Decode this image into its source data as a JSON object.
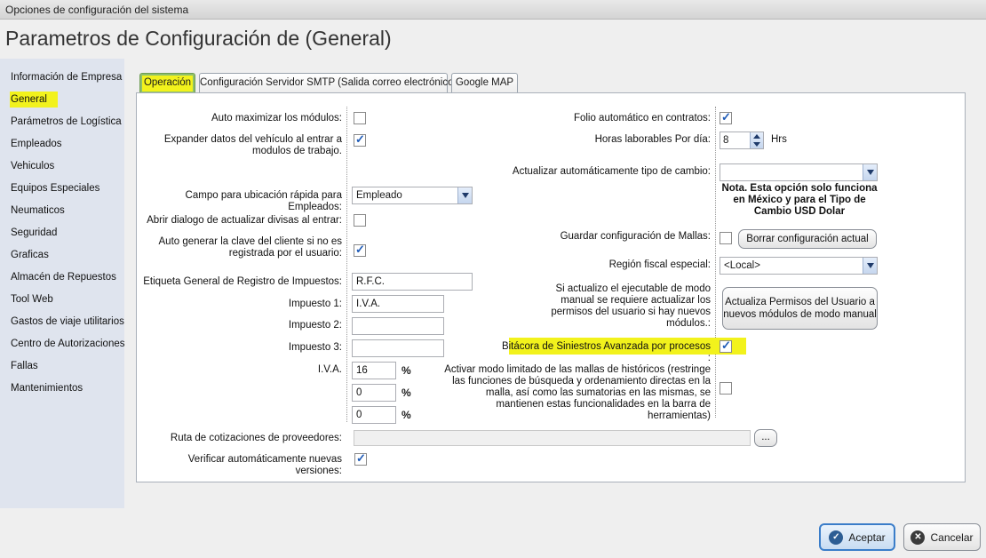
{
  "window_title": "Opciones de configuración del sistema",
  "page_title": "Parametros de Configuración de (General)",
  "sidebar": {
    "items": [
      {
        "label": "Información de Empresa"
      },
      {
        "label": "General"
      },
      {
        "label": "Parámetros de Logística"
      },
      {
        "label": "Empleados"
      },
      {
        "label": "Vehiculos"
      },
      {
        "label": "Equipos Especiales"
      },
      {
        "label": "Neumaticos"
      },
      {
        "label": "Seguridad"
      },
      {
        "label": "Graficas"
      },
      {
        "label": "Almacén de Repuestos"
      },
      {
        "label": "Tool Web"
      },
      {
        "label": "Gastos de viaje utilitarios"
      },
      {
        "label": "Centro de Autorizaciones"
      },
      {
        "label": "Fallas"
      },
      {
        "label": "Mantenimientos"
      }
    ],
    "selected": "General"
  },
  "tabs": [
    {
      "label": "Operación"
    },
    {
      "label": "Configuración Servidor SMTP (Salida correo electrónico)"
    },
    {
      "label": "Google MAP"
    }
  ],
  "left": {
    "auto_max": {
      "label": "Auto maximizar los módulos:",
      "checked": false
    },
    "expand_vehicle": {
      "label": "Expander datos del vehículo al entrar a modulos de trabajo.",
      "checked": true
    },
    "quick_field": {
      "label": "Campo para ubicación rápida para Empleados:",
      "value": "Empleado"
    },
    "currency_dialog": {
      "label": "Abrir dialogo de actualizar divisas al entrar:",
      "checked": false
    },
    "auto_client_key": {
      "label": "Auto generar la clave del cliente si no es registrada por el usuario:",
      "checked": true
    },
    "tax_label": {
      "label": "Etiqueta General de Registro de Impuestos:",
      "value": "R.F.C."
    },
    "impuesto1": {
      "label": "Impuesto 1:",
      "value": "I.V.A."
    },
    "impuesto2": {
      "label": "Impuesto 2:",
      "value": ""
    },
    "impuesto3": {
      "label": "Impuesto 3:",
      "value": ""
    },
    "iva": {
      "label": "I.V.A.",
      "values": [
        "16",
        "0",
        "0"
      ],
      "unit": "%"
    }
  },
  "right": {
    "folio": {
      "label": "Folio automático en contratos:",
      "checked": true
    },
    "work_hours": {
      "label": "Horas laborables Por día:",
      "value": "8",
      "unit": "Hrs"
    },
    "exchange_rate": {
      "label": "Actualizar automáticamente tipo de cambio:",
      "value": ""
    },
    "exchange_note": "Nota. Esta opción solo funciona en México y para el Tipo de Cambio USD Dolar",
    "tire_config": {
      "label": "Guardar configuración de Mallas:",
      "checked": false,
      "button": "Borrar configuración actual"
    },
    "fiscal_region": {
      "label": "Región fiscal especial:",
      "value": "<Local>"
    },
    "permissions": {
      "label": "Si actualizo el ejecutable de modo manual se requiere actualizar los permisos del usuario si hay nuevos módulos.:",
      "button": "Actualiza Permisos del Usuario a nuevos módulos de modo manual"
    },
    "incident_log": {
      "label": "Bitácora de Siniestros Avanzada por procesos :",
      "checked": true
    },
    "limited_mode": {
      "label": "Activar modo limitado de las mallas de históricos (restringe las funciones de búsqueda y ordenamiento directas en la malla, así como las sumatorias en las mismas, se mantienen estas funcionalidades en la barra de herramientas)",
      "checked": false
    }
  },
  "bottom": {
    "quotes_path": {
      "label": "Ruta de cotizaciones de proveedores:",
      "value": "",
      "browse": "..."
    },
    "auto_update": {
      "label": "Verificar automáticamente nuevas versiones:",
      "checked": true
    }
  },
  "footer": {
    "accept": "Aceptar",
    "cancel": "Cancelar"
  },
  "colors": {
    "highlight": "#f2f21c",
    "sidebar_bg": "#dfe4ee",
    "accent": "#2c5d94"
  }
}
